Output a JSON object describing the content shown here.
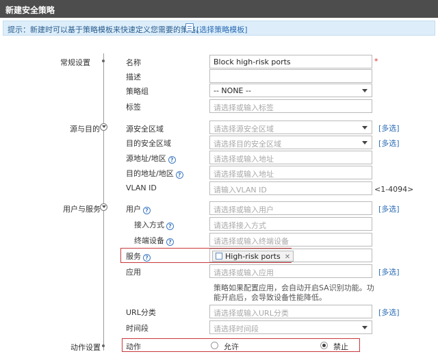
{
  "header": {
    "title": "新建安全策略"
  },
  "tip": {
    "text": "提示：新建时可以基于策略模板来快速定义您需要的策略。",
    "link_label": "[选择策略模板]"
  },
  "sections": {
    "general": "常规设置",
    "source_dest": "源与目的",
    "user_service": "用户与服务",
    "action": "动作设置"
  },
  "fields": {
    "name": {
      "label": "名称",
      "value": "Block high-risk ports",
      "required_mark": "*"
    },
    "description": {
      "label": "描述",
      "value": ""
    },
    "policy_group": {
      "label": "策略组",
      "value": "-- NONE --"
    },
    "tag": {
      "label": "标签",
      "placeholder": "请选择或输入标签"
    },
    "src_zone": {
      "label": "源安全区域",
      "placeholder": "请选择源安全区域"
    },
    "dst_zone": {
      "label": "目的安全区域",
      "placeholder": "请选择目的安全区域"
    },
    "src_addr": {
      "label": "源地址/地区",
      "placeholder": "请选择或输入地址"
    },
    "dst_addr": {
      "label": "目的地址/地区",
      "placeholder": "请选择或输入地址"
    },
    "vlan": {
      "label": "VLAN ID",
      "placeholder": "请输入VLAN ID",
      "range": "<1-4094>"
    },
    "user": {
      "label": "用户",
      "placeholder": "请选择或输入用户"
    },
    "access_mode": {
      "label": "接入方式",
      "placeholder": "请选择接入方式"
    },
    "terminal": {
      "label": "终端设备",
      "placeholder": "请选择或输入终端设备"
    },
    "service": {
      "label": "服务",
      "tag_value": "High-risk ports",
      "tag_close": "✕"
    },
    "application": {
      "label": "应用",
      "placeholder": "请选择或输入应用",
      "note": "策略如果配置应用，会自动开启SA识别功能。功能开启后，会导致设备性能降低。"
    },
    "url_category": {
      "label": "URL分类",
      "placeholder": "请选择或输入URL分类"
    },
    "time_range": {
      "label": "时间段",
      "placeholder": "请选择时间段"
    },
    "action": {
      "label": "动作",
      "allow": "允许",
      "deny": "禁止",
      "selected": "deny"
    }
  },
  "multi_select_label": "[多选]",
  "icons": [
    "template-icon",
    "help-icon",
    "collapse-icon",
    "service-icon",
    "dropdown-caret-icon"
  ],
  "colors": {
    "header_bg": "#4d4d4d",
    "tip_bg": "#ddeefa",
    "link": "#2a6bb5",
    "highlight_border": "#c8373a",
    "required": "#d9302c"
  }
}
